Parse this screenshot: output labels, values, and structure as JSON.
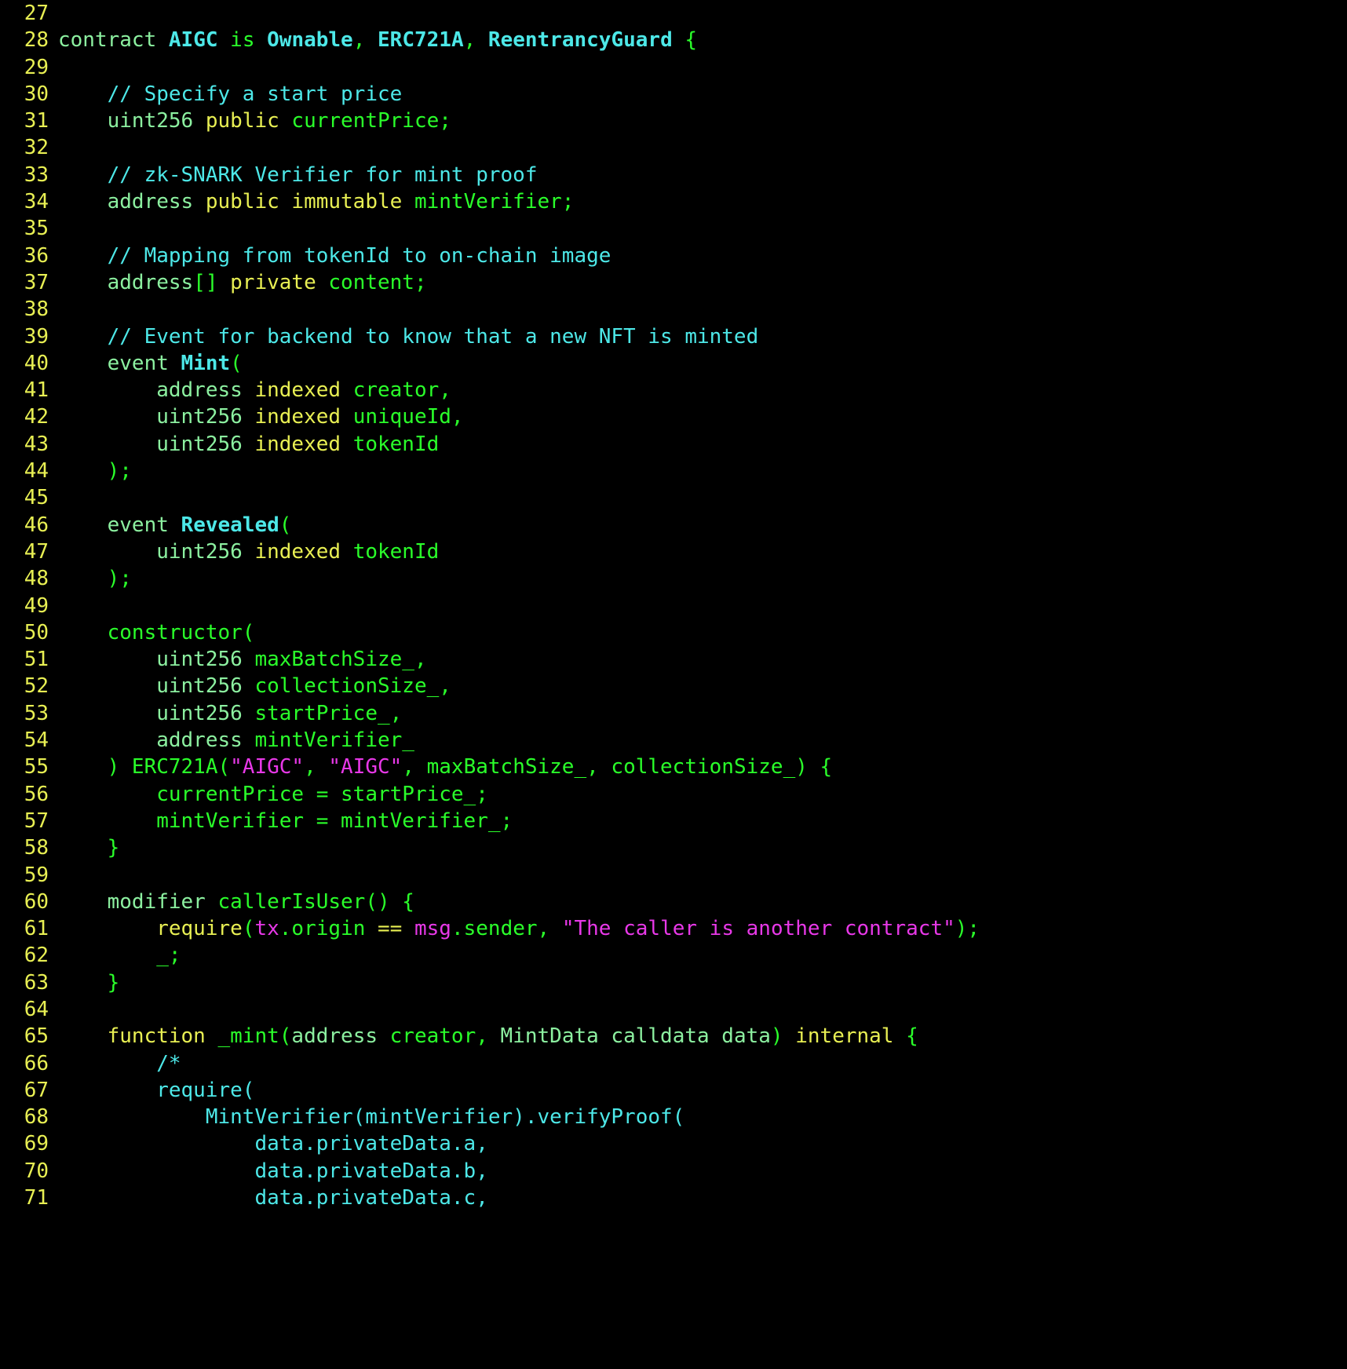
{
  "editor": {
    "language": "solidity",
    "theme": "dark-terminal",
    "background_color": "#000000",
    "first_line_number": 27,
    "last_line_number": 71,
    "line_number_color": "#e8ef53",
    "colors": {
      "keyword": "#e8ef53",
      "type": "#8cf0a0",
      "identifier": "#2aff2a",
      "class": "#4de8e8",
      "comment": "#4de8e8",
      "string": "#e838e8",
      "global": "#e838e8",
      "punctuation": "#2aff2a"
    }
  },
  "lines": [
    {
      "n": "27",
      "tokens": []
    },
    {
      "n": "28",
      "tokens": [
        {
          "t": "contract ",
          "c": "t-type"
        },
        {
          "t": "AIGC",
          "c": "t-classb"
        },
        {
          "t": " ",
          "c": "t-plain"
        },
        {
          "t": "is",
          "c": "t-ident"
        },
        {
          "t": " ",
          "c": "t-plain"
        },
        {
          "t": "Ownable",
          "c": "t-classb"
        },
        {
          "t": ",",
          "c": "t-ident"
        },
        {
          "t": " ",
          "c": "t-plain"
        },
        {
          "t": "ERC721A",
          "c": "t-classb"
        },
        {
          "t": ",",
          "c": "t-ident"
        },
        {
          "t": " ",
          "c": "t-plain"
        },
        {
          "t": "ReentrancyGuard",
          "c": "t-classb"
        },
        {
          "t": " {",
          "c": "t-ident"
        }
      ]
    },
    {
      "n": "29",
      "tokens": []
    },
    {
      "n": "30",
      "tokens": [
        {
          "t": "    // Specify a start price",
          "c": "t-comment"
        }
      ]
    },
    {
      "n": "31",
      "tokens": [
        {
          "t": "    uint256 ",
          "c": "t-type"
        },
        {
          "t": "public ",
          "c": "t-kw"
        },
        {
          "t": "currentPrice;",
          "c": "t-ident"
        }
      ]
    },
    {
      "n": "32",
      "tokens": []
    },
    {
      "n": "33",
      "tokens": [
        {
          "t": "    // zk-SNARK Verifier for mint proof",
          "c": "t-comment"
        }
      ]
    },
    {
      "n": "34",
      "tokens": [
        {
          "t": "    address ",
          "c": "t-type"
        },
        {
          "t": "public immutable ",
          "c": "t-kw"
        },
        {
          "t": "mintVerifier;",
          "c": "t-ident"
        }
      ]
    },
    {
      "n": "35",
      "tokens": []
    },
    {
      "n": "36",
      "tokens": [
        {
          "t": "    // Mapping from tokenId to on-chain image",
          "c": "t-comment"
        }
      ]
    },
    {
      "n": "37",
      "tokens": [
        {
          "t": "    address",
          "c": "t-type"
        },
        {
          "t": "[] ",
          "c": "t-ident"
        },
        {
          "t": "private ",
          "c": "t-kw"
        },
        {
          "t": "content;",
          "c": "t-ident"
        }
      ]
    },
    {
      "n": "38",
      "tokens": []
    },
    {
      "n": "39",
      "tokens": [
        {
          "t": "    // Event for backend to know that a new NFT is minted",
          "c": "t-comment"
        }
      ]
    },
    {
      "n": "40",
      "tokens": [
        {
          "t": "    event ",
          "c": "t-type"
        },
        {
          "t": "Mint",
          "c": "t-classb"
        },
        {
          "t": "(",
          "c": "t-ident"
        }
      ]
    },
    {
      "n": "41",
      "tokens": [
        {
          "t": "        address ",
          "c": "t-type"
        },
        {
          "t": "indexed ",
          "c": "t-kw"
        },
        {
          "t": "creator,",
          "c": "t-ident"
        }
      ]
    },
    {
      "n": "42",
      "tokens": [
        {
          "t": "        uint256 ",
          "c": "t-type"
        },
        {
          "t": "indexed ",
          "c": "t-kw"
        },
        {
          "t": "uniqueId,",
          "c": "t-ident"
        }
      ]
    },
    {
      "n": "43",
      "tokens": [
        {
          "t": "        uint256 ",
          "c": "t-type"
        },
        {
          "t": "indexed ",
          "c": "t-kw"
        },
        {
          "t": "tokenId",
          "c": "t-ident"
        }
      ]
    },
    {
      "n": "44",
      "tokens": [
        {
          "t": "    );",
          "c": "t-ident"
        }
      ]
    },
    {
      "n": "45",
      "tokens": []
    },
    {
      "n": "46",
      "tokens": [
        {
          "t": "    event ",
          "c": "t-type"
        },
        {
          "t": "Revealed",
          "c": "t-classb"
        },
        {
          "t": "(",
          "c": "t-ident"
        }
      ]
    },
    {
      "n": "47",
      "tokens": [
        {
          "t": "        uint256 ",
          "c": "t-type"
        },
        {
          "t": "indexed ",
          "c": "t-kw"
        },
        {
          "t": "tokenId",
          "c": "t-ident"
        }
      ]
    },
    {
      "n": "48",
      "tokens": [
        {
          "t": "    );",
          "c": "t-ident"
        }
      ]
    },
    {
      "n": "49",
      "tokens": []
    },
    {
      "n": "50",
      "tokens": [
        {
          "t": "    constructor(",
          "c": "t-ident"
        }
      ]
    },
    {
      "n": "51",
      "tokens": [
        {
          "t": "        uint256 ",
          "c": "t-type"
        },
        {
          "t": "maxBatchSize_,",
          "c": "t-ident"
        }
      ]
    },
    {
      "n": "52",
      "tokens": [
        {
          "t": "        uint256 ",
          "c": "t-type"
        },
        {
          "t": "collectionSize_,",
          "c": "t-ident"
        }
      ]
    },
    {
      "n": "53",
      "tokens": [
        {
          "t": "        uint256 ",
          "c": "t-type"
        },
        {
          "t": "startPrice_,",
          "c": "t-ident"
        }
      ]
    },
    {
      "n": "54",
      "tokens": [
        {
          "t": "        address ",
          "c": "t-type"
        },
        {
          "t": "mintVerifier_",
          "c": "t-ident"
        }
      ]
    },
    {
      "n": "55",
      "tokens": [
        {
          "t": "    ) ERC721A(",
          "c": "t-ident"
        },
        {
          "t": "\"AIGC\"",
          "c": "t-string"
        },
        {
          "t": ", ",
          "c": "t-ident"
        },
        {
          "t": "\"AIGC\"",
          "c": "t-string"
        },
        {
          "t": ", maxBatchSize_, collectionSize_) {",
          "c": "t-ident"
        }
      ]
    },
    {
      "n": "56",
      "tokens": [
        {
          "t": "        currentPrice = startPrice_;",
          "c": "t-ident"
        }
      ]
    },
    {
      "n": "57",
      "tokens": [
        {
          "t": "        mintVerifier = mintVerifier_;",
          "c": "t-ident"
        }
      ]
    },
    {
      "n": "58",
      "tokens": [
        {
          "t": "    }",
          "c": "t-ident"
        }
      ]
    },
    {
      "n": "59",
      "tokens": []
    },
    {
      "n": "60",
      "tokens": [
        {
          "t": "    modifier ",
          "c": "t-type"
        },
        {
          "t": "callerIsUser() {",
          "c": "t-ident"
        }
      ]
    },
    {
      "n": "61",
      "tokens": [
        {
          "t": "        require",
          "c": "t-kw"
        },
        {
          "t": "(",
          "c": "t-ident"
        },
        {
          "t": "tx",
          "c": "t-magic"
        },
        {
          "t": ".origin ",
          "c": "t-ident"
        },
        {
          "t": "==",
          "c": "t-kw"
        },
        {
          "t": " ",
          "c": "t-ident"
        },
        {
          "t": "msg",
          "c": "t-magic"
        },
        {
          "t": ".sender, ",
          "c": "t-ident"
        },
        {
          "t": "\"The caller is another contract\"",
          "c": "t-string"
        },
        {
          "t": ");",
          "c": "t-ident"
        }
      ]
    },
    {
      "n": "62",
      "tokens": [
        {
          "t": "        _;",
          "c": "t-ident"
        }
      ]
    },
    {
      "n": "63",
      "tokens": [
        {
          "t": "    }",
          "c": "t-ident"
        }
      ]
    },
    {
      "n": "64",
      "tokens": []
    },
    {
      "n": "65",
      "tokens": [
        {
          "t": "    function ",
          "c": "t-kw"
        },
        {
          "t": "_mint(",
          "c": "t-ident"
        },
        {
          "t": "address ",
          "c": "t-type"
        },
        {
          "t": "creator, ",
          "c": "t-ident"
        },
        {
          "t": "MintData calldata data",
          "c": "t-type"
        },
        {
          "t": ") ",
          "c": "t-ident"
        },
        {
          "t": "internal ",
          "c": "t-kw"
        },
        {
          "t": "{",
          "c": "t-ident"
        }
      ]
    },
    {
      "n": "66",
      "tokens": [
        {
          "t": "        /*",
          "c": "t-comment"
        }
      ]
    },
    {
      "n": "67",
      "tokens": [
        {
          "t": "        require(",
          "c": "t-comment"
        }
      ]
    },
    {
      "n": "68",
      "tokens": [
        {
          "t": "            MintVerifier(mintVerifier).verifyProof(",
          "c": "t-comment"
        }
      ]
    },
    {
      "n": "69",
      "tokens": [
        {
          "t": "                data.privateData.a,",
          "c": "t-comment"
        }
      ]
    },
    {
      "n": "70",
      "tokens": [
        {
          "t": "                data.privateData.b,",
          "c": "t-comment"
        }
      ]
    },
    {
      "n": "71",
      "tokens": [
        {
          "t": "                data.privateData.c,",
          "c": "t-comment"
        }
      ]
    }
  ]
}
